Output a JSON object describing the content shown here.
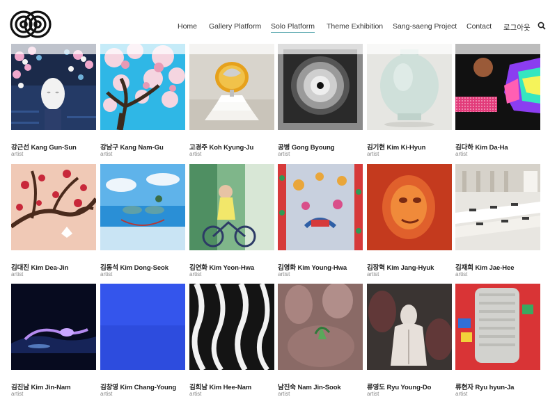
{
  "nav": {
    "items": [
      "Home",
      "Gallery Platform",
      "Solo Platform",
      "Theme Exhibition",
      "Sang-saeng Project",
      "Contact",
      "로그아웃"
    ],
    "active_index": 2,
    "accent_color": "#4aa0a8"
  },
  "icons": {
    "logo": "site-logo",
    "search": "search-icon"
  },
  "artists": [
    {
      "name": "강근선 Kang Gun-Sun",
      "role": "artist"
    },
    {
      "name": "강남구 Kang Nam-Gu",
      "role": "artist"
    },
    {
      "name": "고경주 Koh Kyung-Ju",
      "role": "artist"
    },
    {
      "name": "공병 Gong Byoung",
      "role": "artist"
    },
    {
      "name": "김기현 Kim Ki-Hyun",
      "role": "artist"
    },
    {
      "name": "김다하 Kim Da-Ha",
      "role": "artist"
    },
    {
      "name": "김대진 Kim Dea-Jin",
      "role": "artist"
    },
    {
      "name": "김동석 Kim Dong-Seok",
      "role": "artist"
    },
    {
      "name": "김연화 Kim Yeon-Hwa",
      "role": "artist"
    },
    {
      "name": "김영화 Kim Young-Hwa",
      "role": "artist"
    },
    {
      "name": "김장혁 Kim Jang-Hyuk",
      "role": "artist"
    },
    {
      "name": "김재희 Kim Jae-Hee",
      "role": "artist"
    },
    {
      "name": "김진남 Kim Jin-Nam",
      "role": "artist"
    },
    {
      "name": "김창영 Kim Chang-Young",
      "role": "artist"
    },
    {
      "name": "김희남 Kim Hee-Nam",
      "role": "artist"
    },
    {
      "name": "남진숙 Nam Jin-Sook",
      "role": "artist"
    },
    {
      "name": "류영도 Ryu Young-Do",
      "role": "artist"
    },
    {
      "name": "류현자 Ryu hyun-Ja",
      "role": "artist"
    }
  ]
}
